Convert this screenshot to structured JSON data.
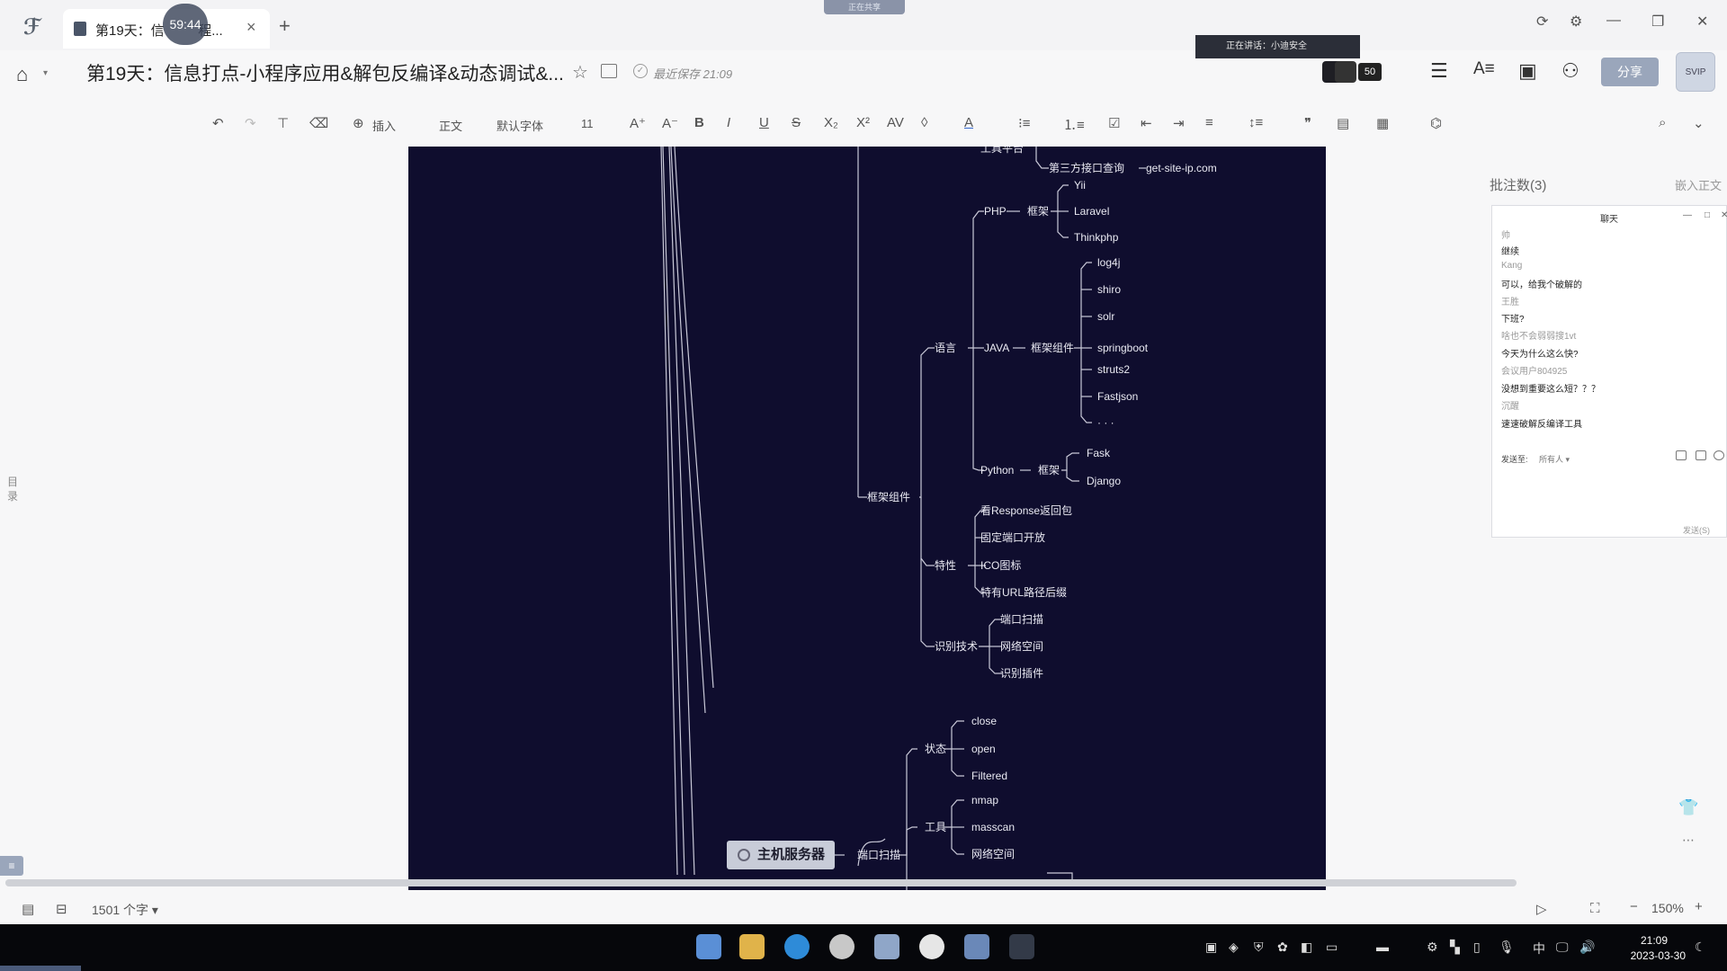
{
  "window": {
    "tab_label": "第19天：信",
    "tab_label_tail": "程...",
    "timer": "59:44",
    "top_pill": "正在共享",
    "speaking_banner": "正在讲话：小迪安全"
  },
  "header": {
    "title": "第19天：信息打点-小程序应用&解包反编译&动态调试&...",
    "saved_status": "最近保存 21:09",
    "collab_count": "50",
    "share_label": "分享",
    "avatar_label": "SVIP"
  },
  "toolbar": {
    "insert_label": "插入",
    "style_label": "正文",
    "font_label": "默认字体",
    "size_label": "11"
  },
  "mindmap": {
    "root": "主机服务器",
    "nodes": {
      "third_party": "第三方接口查询",
      "get_site_ip": "get-site-ip.com",
      "tool_platform": "工具平台",
      "php": "PHP",
      "php_fw": "框架",
      "yii": "Yii",
      "laravel": "Laravel",
      "thinkphp": "Thinkphp",
      "lang": "语言",
      "java": "JAVA",
      "java_fw": "框架组件",
      "log4j": "log4j",
      "shiro": "shiro",
      "solr": "solr",
      "springboot": "springboot",
      "struts2": "struts2",
      "fastjson": "Fastjson",
      "ellipsis": "· · ·",
      "python": "Python",
      "py_fw": "框架",
      "flask": "Fask",
      "django": "Django",
      "framework_component": "框架组件",
      "feature": "特性",
      "response_pkg": "看Response返回包",
      "fixed_port": "固定端口开放",
      "ico": "ICO图标",
      "url_suffix": "特有URL路径后缀",
      "recog": "识别技术",
      "port_scan_tech": "端口扫描",
      "cyberspace_tech": "网络空间",
      "plugin_tech": "识别插件",
      "port_scan": "端口扫描",
      "status": "状态",
      "close": "close",
      "open": "open",
      "filtered": "Filtered",
      "tools": "工具",
      "nmap": "nmap",
      "masscan": "masscan",
      "cyberspace": "网络空间"
    }
  },
  "comments": {
    "title": "批注数(3)",
    "embed_label": "嵌入正文",
    "chat_title": "聊天",
    "messages": [
      {
        "name": "帅",
        "text": "继续"
      },
      {
        "name": "Kang",
        "text": "可以，给我个破解的"
      },
      {
        "name": "王胜",
        "text": "下班?"
      },
      {
        "name": "啥也不会弱弱搜1vt",
        "text": "今天为什么这么快?"
      },
      {
        "name": "会议用户804925",
        "text": "没想到重要这么短？？？"
      },
      {
        "name": "沉醒",
        "text": "速速破解反编译工具"
      }
    ],
    "send_to_label": "发送至:",
    "send_to_value": "所有人",
    "send_button": "发送(S)"
  },
  "sidebar": {
    "toc_label": "目录"
  },
  "status": {
    "word_count": "1501 个字",
    "zoom": "150%"
  },
  "taskbar": {
    "time": "21:09",
    "date": "2023-03-30",
    "ime": "中"
  }
}
